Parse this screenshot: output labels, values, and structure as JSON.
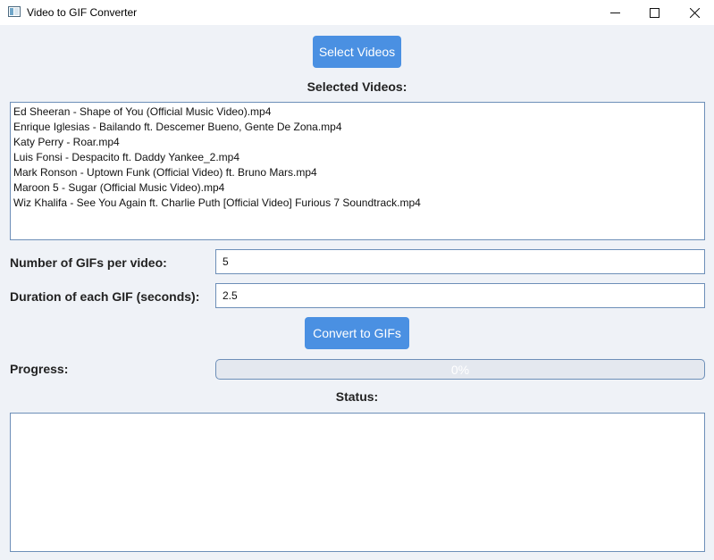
{
  "window": {
    "title": "Video to GIF Converter"
  },
  "toolbar": {
    "select_label": "Select Videos",
    "convert_label": "Convert to GIFs"
  },
  "selected": {
    "label": "Selected Videos:",
    "items": [
      "Ed Sheeran - Shape of You (Official Music Video).mp4",
      "Enrique Iglesias - Bailando ft. Descemer Bueno, Gente De Zona.mp4",
      "Katy Perry - Roar.mp4",
      "Luis Fonsi - Despacito ft. Daddy Yankee_2.mp4",
      "Mark Ronson - Uptown Funk (Official Video) ft. Bruno Mars.mp4",
      "Maroon 5 - Sugar (Official Music Video).mp4",
      "Wiz Khalifa - See You Again ft. Charlie Puth [Official Video] Furious 7 Soundtrack.mp4"
    ]
  },
  "settings": {
    "gif_count_label": "Number of GIFs per video:",
    "gif_count_value": "5",
    "duration_label": "Duration of each GIF (seconds):",
    "duration_value": "2.5"
  },
  "progress": {
    "label": "Progress:",
    "value_fraction": 0,
    "text": "0%"
  },
  "status": {
    "label": "Status:",
    "text": ""
  },
  "colors": {
    "accent": "#4a90e2",
    "background": "#eff2f7",
    "border": "#6d8fb8"
  },
  "icons": {
    "minimize": "minimize-icon",
    "maximize": "maximize-icon",
    "close": "close-icon",
    "app": "app-window-icon"
  }
}
